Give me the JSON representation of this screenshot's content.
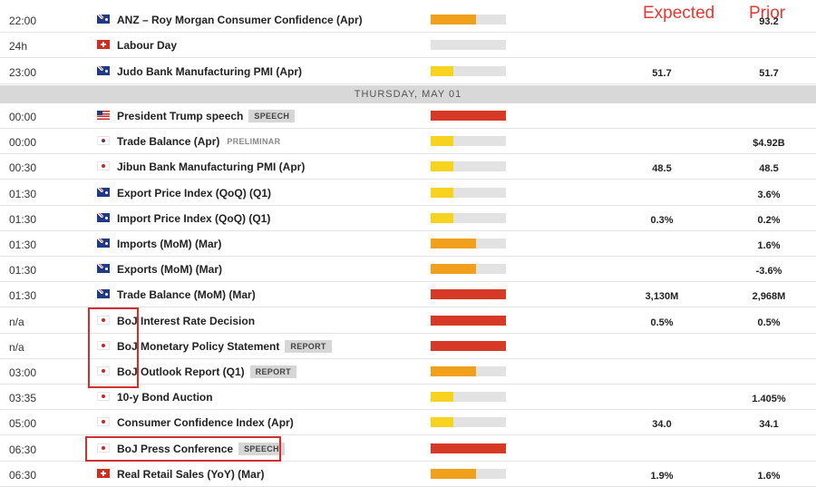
{
  "headers": {
    "expected": "Expected",
    "prior": "Prior"
  },
  "day_header": "THURSDAY, MAY 01",
  "impact_colors": {
    "low": "#f7d21e",
    "medium": "#f0a01a",
    "high": "#d63a26",
    "empty": "#e2e2e2"
  },
  "rows_before": [
    {
      "time": "22:00",
      "flag": "au",
      "country_icon": "australia-flag-icon",
      "event": "ANZ – Roy Morgan Consumer Confidence (Apr)",
      "impact": "medium",
      "impact_fraction": 0.6,
      "expected": "",
      "prior": "93.2"
    },
    {
      "time": "24h",
      "flag": "ch",
      "country_icon": "switzerland-flag-icon",
      "event": "Labour Day",
      "impact": "none",
      "impact_fraction": 0,
      "expected": "",
      "prior": ""
    },
    {
      "time": "23:00",
      "flag": "au",
      "country_icon": "australia-flag-icon",
      "event": "Judo Bank Manufacturing PMI (Apr)",
      "impact": "low",
      "impact_fraction": 0.3,
      "expected": "51.7",
      "prior": "51.7"
    }
  ],
  "rows_after": [
    {
      "time": "00:00",
      "flag": "us",
      "country_icon": "usa-flag-icon",
      "event": "President Trump speech",
      "tag": "SPEECH",
      "impact": "high",
      "impact_fraction": 1,
      "expected": "",
      "prior": ""
    },
    {
      "time": "00:00",
      "flag": "kr",
      "country_icon": "south-korea-flag-icon",
      "event": "Trade Balance (Apr)",
      "tag_plain": "PRELIMINAR",
      "impact": "low",
      "impact_fraction": 0.3,
      "expected": "",
      "prior": "$4.92B"
    },
    {
      "time": "00:30",
      "flag": "jp",
      "country_icon": "japan-flag-icon",
      "event": "Jibun Bank Manufacturing PMI (Apr)",
      "impact": "low",
      "impact_fraction": 0.3,
      "expected": "48.5",
      "prior": "48.5"
    },
    {
      "time": "01:30",
      "flag": "au",
      "country_icon": "australia-flag-icon",
      "event": "Export Price Index (QoQ) (Q1)",
      "impact": "low",
      "impact_fraction": 0.3,
      "expected": "",
      "prior": "3.6%"
    },
    {
      "time": "01:30",
      "flag": "au",
      "country_icon": "australia-flag-icon",
      "event": "Import Price Index (QoQ) (Q1)",
      "impact": "low",
      "impact_fraction": 0.3,
      "expected": "0.3%",
      "prior": "0.2%"
    },
    {
      "time": "01:30",
      "flag": "au",
      "country_icon": "australia-flag-icon",
      "event": "Imports (MoM) (Mar)",
      "impact": "medium",
      "impact_fraction": 0.6,
      "expected": "",
      "prior": "1.6%"
    },
    {
      "time": "01:30",
      "flag": "au",
      "country_icon": "australia-flag-icon",
      "event": "Exports (MoM) (Mar)",
      "impact": "medium",
      "impact_fraction": 0.6,
      "expected": "",
      "prior": "-3.6%"
    },
    {
      "time": "01:30",
      "flag": "au",
      "country_icon": "australia-flag-icon",
      "event": "Trade Balance (MoM) (Mar)",
      "impact": "high",
      "impact_fraction": 1,
      "expected": "3,130M",
      "prior": "2,968M"
    },
    {
      "time": "n/a",
      "flag": "jp",
      "country_icon": "japan-flag-icon",
      "event": "BoJ Interest Rate Decision",
      "impact": "high",
      "impact_fraction": 1,
      "expected": "0.5%",
      "prior": "0.5%"
    },
    {
      "time": "n/a",
      "flag": "jp",
      "country_icon": "japan-flag-icon",
      "event": "BoJ Monetary Policy Statement",
      "tag": "REPORT",
      "impact": "high",
      "impact_fraction": 1,
      "expected": "",
      "prior": ""
    },
    {
      "time": "03:00",
      "flag": "jp",
      "country_icon": "japan-flag-icon",
      "event": "BoJ Outlook Report (Q1)",
      "tag": "REPORT",
      "impact": "medium",
      "impact_fraction": 0.6,
      "expected": "",
      "prior": ""
    },
    {
      "time": "03:35",
      "flag": "jp",
      "country_icon": "japan-flag-icon",
      "event": "10-y Bond Auction",
      "impact": "low",
      "impact_fraction": 0.3,
      "expected": "",
      "prior": "1.405%"
    },
    {
      "time": "05:00",
      "flag": "jp",
      "country_icon": "japan-flag-icon",
      "event": "Consumer Confidence Index (Apr)",
      "impact": "low",
      "impact_fraction": 0.3,
      "expected": "34.0",
      "prior": "34.1"
    },
    {
      "time": "06:30",
      "flag": "jp",
      "country_icon": "japan-flag-icon",
      "event": "BoJ Press Conference",
      "tag": "SPEECH",
      "impact": "high",
      "impact_fraction": 1,
      "expected": "",
      "prior": ""
    },
    {
      "time": "06:30",
      "flag": "ch",
      "country_icon": "switzerland-flag-icon",
      "event": "Real Retail Sales (YoY) (Mar)",
      "impact": "medium",
      "impact_fraction": 0.6,
      "expected": "1.9%",
      "prior": "1.6%"
    }
  ]
}
